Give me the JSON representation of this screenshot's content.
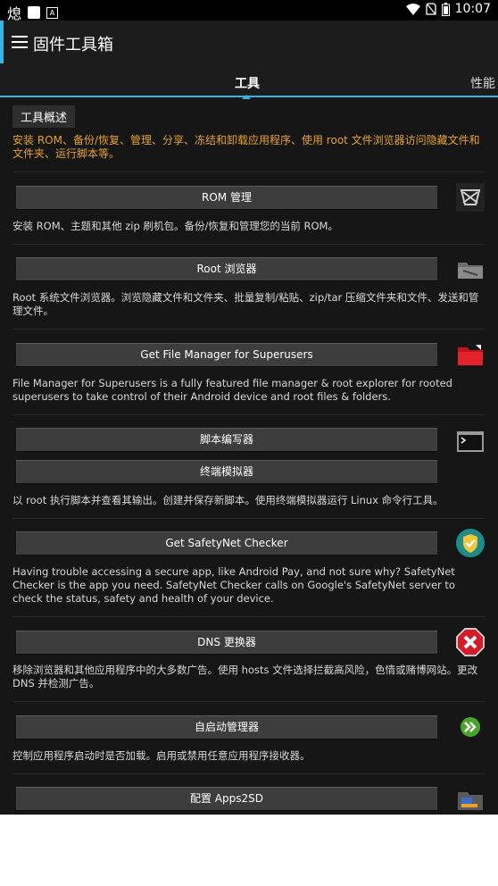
{
  "status_bar": {
    "glyph_left": "熄",
    "time": "10:07"
  },
  "toolbar": {
    "title": "固件工具箱"
  },
  "tabs": [
    {
      "label": "工具"
    },
    {
      "label": "性能"
    }
  ],
  "overview": {
    "heading": "工具概述",
    "text": "安装 ROM、备份/恢复、管理、分享、冻结和卸载应用程序、使用 root 文件浏览器访问隐藏文件和文件夹、运行脚本等。"
  },
  "sections": {
    "rom": {
      "button": "ROM 管理",
      "desc": "安装 ROM、主题和其他 zip 刷机包。备份/恢复和管理您的当前 ROM。",
      "icon": "rom-icon"
    },
    "root": {
      "button": "Root 浏览器",
      "desc": "Root 系统文件浏览器。浏览隐藏文件和文件夹、批量复制/粘贴、zip/tar 压缩文件夹和文件、发送和管理文件。",
      "icon": "folder-icon"
    },
    "fm": {
      "button": "Get File Manager for Superusers",
      "desc": "File Manager for Superusers is a fully featured file manager & root explorer for rooted superusers to take control of their Android device and root files & folders.",
      "icon": "red-folder-icon"
    },
    "script": {
      "button1": "脚本编写器",
      "button2": "终端模拟器",
      "desc": "以 root 执行脚本并查看其输出。创建并保存新脚本。使用终端模拟器运行 Linux 命令行工具。",
      "icon": "terminal-icon"
    },
    "safety": {
      "button": "Get SafetyNet Checker",
      "desc": "Having trouble accessing a secure app, like Android Pay, and not sure why? SafetyNet Checker is the app you need. SafetyNet Checker calls on Google's SafetyNet server to check the status, safety and health of your device.",
      "icon": "shield-check-icon"
    },
    "dns": {
      "button": "DNS 更换器",
      "desc": "移除浏览器和其他应用程序中的大多数广告。使用 hosts 文件选择拦截高风险，色情或赌博网站。更改 DNS 并检测广告。",
      "icon": "block-icon"
    },
    "autostart": {
      "button": "自启动管理器",
      "desc": "控制应用程序启动时是否加载。启用或禁用任意应用程序接收器。",
      "icon": "fast-forward-icon"
    },
    "apps2sd": {
      "button": "配置 Apps2SD",
      "icon": "sd-folder-icon"
    }
  },
  "colors": {
    "accent": "#33b5e5",
    "overview_text": "#e8a22b",
    "background": "#161616"
  }
}
